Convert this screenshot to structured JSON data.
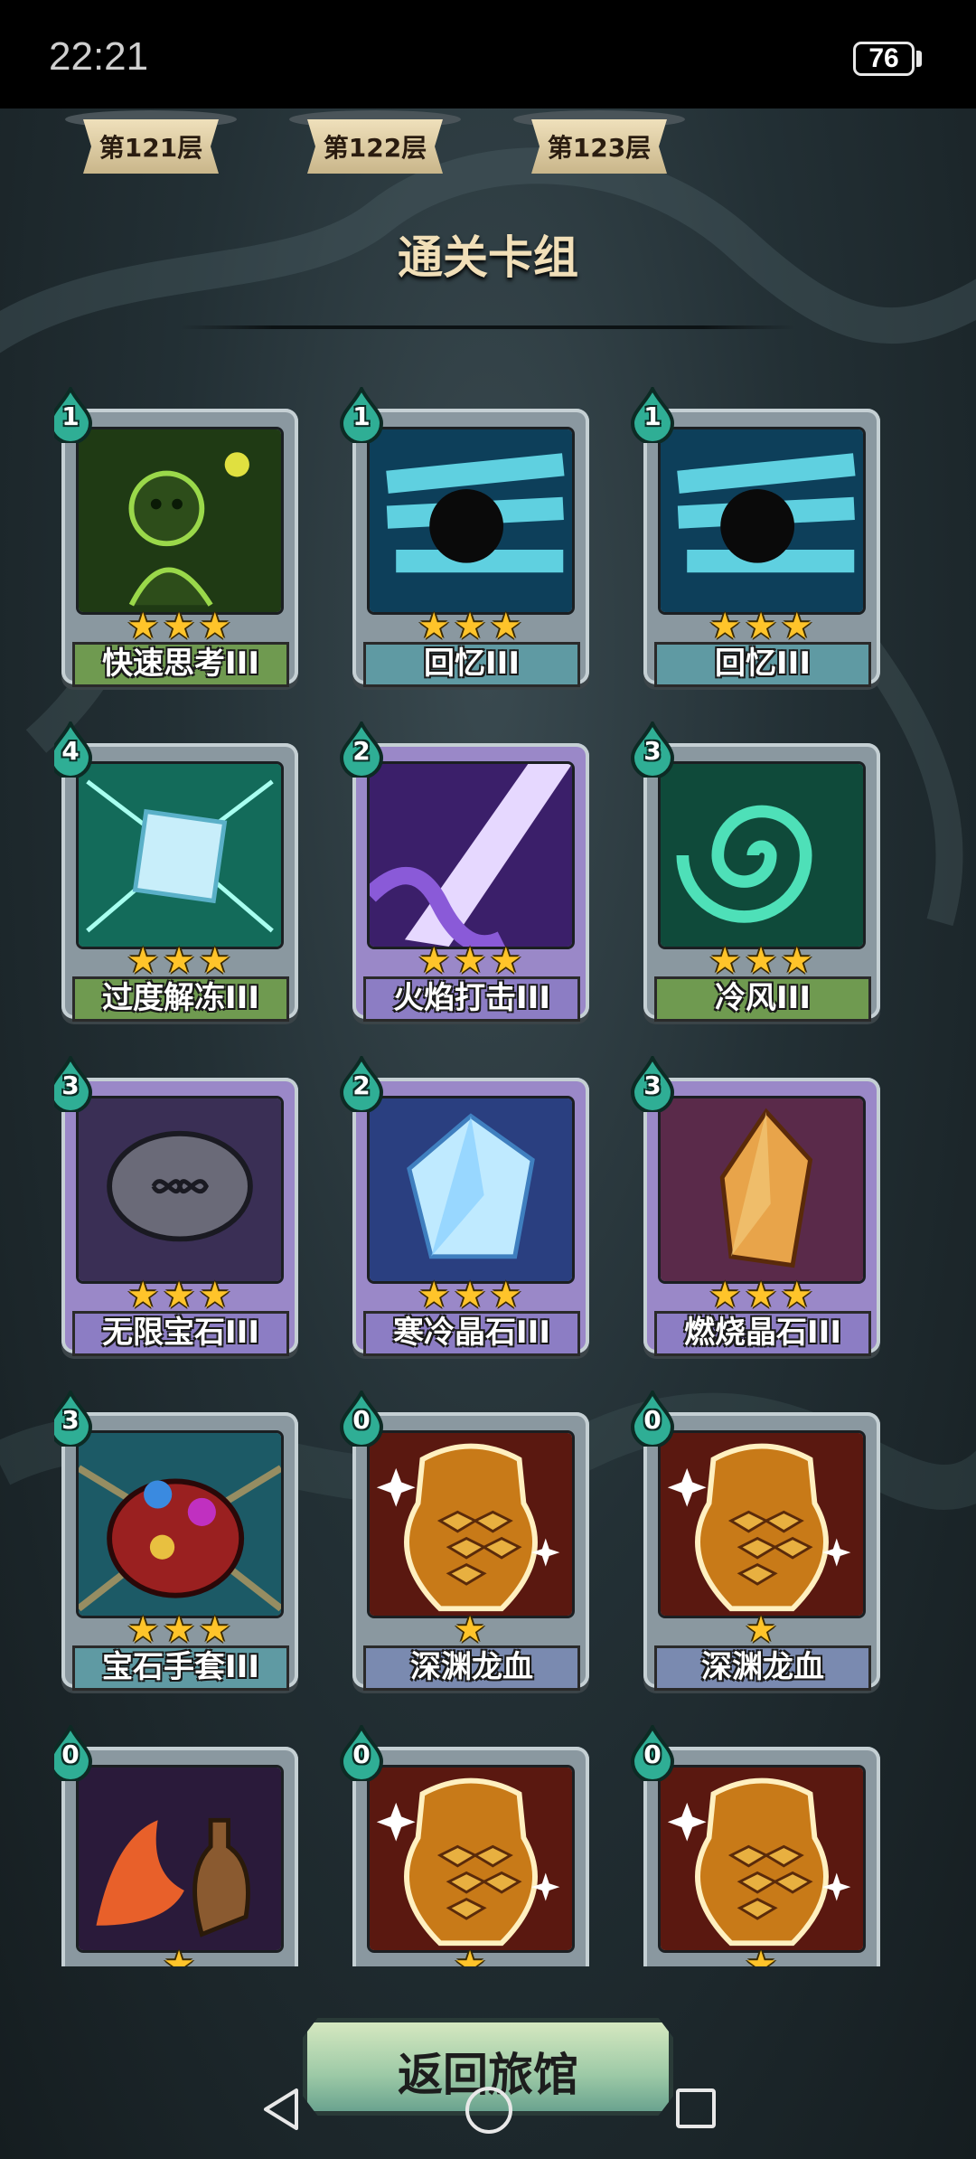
{
  "status_bar": {
    "time": "22:21",
    "battery": "76"
  },
  "floor_tabs": [
    {
      "label": "第121层"
    },
    {
      "label": "第122层"
    },
    {
      "label": "第123层"
    }
  ],
  "page_title": "通关卡组",
  "cards": [
    {
      "name": "快速思考III",
      "cost": "1",
      "stars": 3,
      "ribbon_color": "#6f9a50",
      "frame_color": "#8a98a0",
      "art": "think-figure",
      "art_bg": "#1f3a14"
    },
    {
      "name": "回忆III",
      "cost": "1",
      "stars": 3,
      "ribbon_color": "#5f9aa3",
      "frame_color": "#8a98a0",
      "art": "recall-swirl",
      "art_bg": "#0d3f5a"
    },
    {
      "name": "回忆III",
      "cost": "1",
      "stars": 3,
      "ribbon_color": "#5f9aa3",
      "frame_color": "#8a98a0",
      "art": "recall-swirl",
      "art_bg": "#0d3f5a"
    },
    {
      "name": "过度解冻III",
      "cost": "4",
      "stars": 3,
      "ribbon_color": "#6f9a50",
      "frame_color": "#8a98a0",
      "art": "ice-cube",
      "art_bg": "#136b5a"
    },
    {
      "name": "火焰打击III",
      "cost": "2",
      "stars": 3,
      "ribbon_color": "#8c7dc4",
      "frame_color": "#9a88c8",
      "art": "flame-strike",
      "art_bg": "#3b1f6a"
    },
    {
      "name": "冷风III",
      "cost": "3",
      "stars": 3,
      "ribbon_color": "#6f9a50",
      "frame_color": "#8a98a0",
      "art": "cold-wind",
      "art_bg": "#0f4a3a"
    },
    {
      "name": "无限宝石III",
      "cost": "3",
      "stars": 3,
      "ribbon_color": "#8c7dc4",
      "frame_color": "#9a88c8",
      "art": "infinity-gem",
      "art_bg": "#3a2f55"
    },
    {
      "name": "寒冷晶石III",
      "cost": "2",
      "stars": 3,
      "ribbon_color": "#8c7dc4",
      "frame_color": "#9a88c8",
      "art": "cold-crystal",
      "art_bg": "#2a3f80"
    },
    {
      "name": "燃烧晶石III",
      "cost": "3",
      "stars": 3,
      "ribbon_color": "#8c7dc4",
      "frame_color": "#9a88c8",
      "art": "burn-crystal",
      "art_bg": "#5a2a4a"
    },
    {
      "name": "宝石手套III",
      "cost": "3",
      "stars": 3,
      "ribbon_color": "#5f9aa3",
      "frame_color": "#8a98a0",
      "art": "gem-gauntlet",
      "art_bg": "#1c5a66"
    },
    {
      "name": "深渊龙血",
      "cost": "0",
      "stars": 1,
      "ribbon_color": "#7a8ab0",
      "frame_color": "#8a98a0",
      "art": "dragon-blood",
      "art_bg": "#5a1810"
    },
    {
      "name": "深渊龙血",
      "cost": "0",
      "stars": 1,
      "ribbon_color": "#7a8ab0",
      "frame_color": "#8a98a0",
      "art": "dragon-blood",
      "art_bg": "#5a1810"
    },
    {
      "name": "",
      "cost": "0",
      "stars": 1,
      "ribbon_color": "#7a8ab0",
      "frame_color": "#8a98a0",
      "art": "fire-flask",
      "art_bg": "#2a1a3a"
    },
    {
      "name": "",
      "cost": "0",
      "stars": 1,
      "ribbon_color": "#7a8ab0",
      "frame_color": "#8a98a0",
      "art": "dragon-blood",
      "art_bg": "#5a1810"
    },
    {
      "name": "",
      "cost": "0",
      "stars": 1,
      "ribbon_color": "#7a8ab0",
      "frame_color": "#8a98a0",
      "art": "dragon-blood",
      "art_bg": "#5a1810"
    }
  ],
  "return_button": {
    "label": "返回旅馆"
  }
}
